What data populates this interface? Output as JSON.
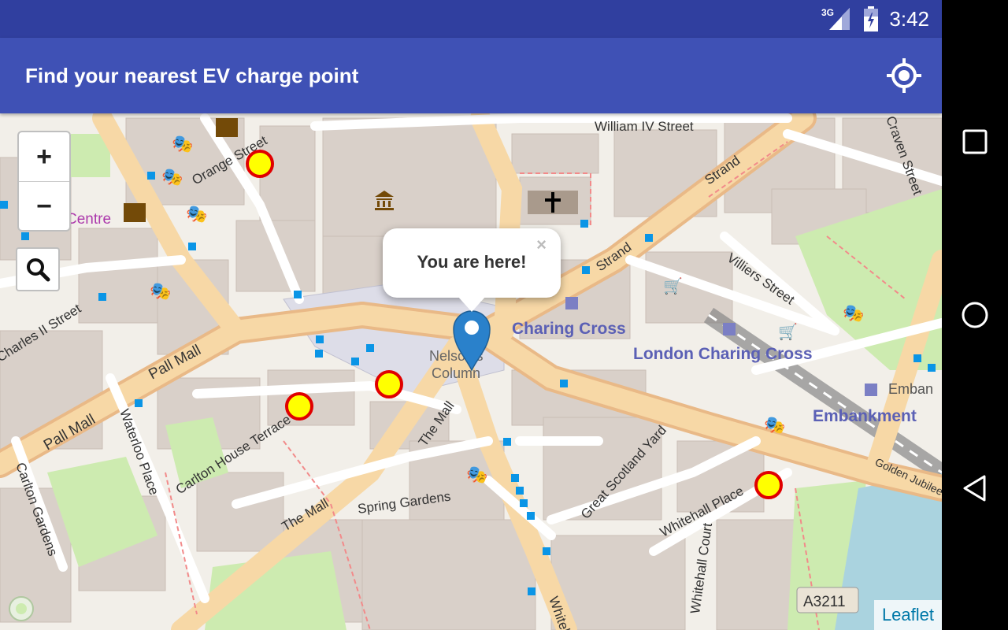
{
  "status_bar": {
    "network": "3G",
    "time": "3:42"
  },
  "app_bar": {
    "title": "Find your nearest EV charge point",
    "locate_icon": "my-location-icon"
  },
  "map": {
    "zoom_in_label": "+",
    "zoom_out_label": "−",
    "search_icon": "search-icon",
    "popup_text": "You are here!",
    "popup_close": "×",
    "attribution": "Leaflet",
    "labels": {
      "william_iv": "William IV Street",
      "strand_1": "Strand",
      "strand_2": "Strand",
      "orange_st": "Orange Street",
      "pall_mall_1": "Pall Mall",
      "pall_mall_2": "Pall Mall",
      "charles_ii": "Charles II Street",
      "waterloo_place": "Waterloo Place",
      "carlton_gardens": "Carlton Gardens",
      "carlton_house_terrace": "Carlton House Terrace",
      "the_mall_1": "The Mall",
      "the_mall_2": "The Mall",
      "spring_gardens": "Spring Gardens",
      "great_scotland_yard": "Great Scotland Yard",
      "whitehall_place": "Whitehall Place",
      "whitehall_court": "Whitehall Court",
      "whitehall": "Whitehall",
      "villiers_st": "Villiers Street",
      "charing_cross": "Charing Cross",
      "london_charing_cross": "London Charing Cross",
      "embankment": "Embankment",
      "emban": "Emban",
      "nelsons_column_1": "Nelson's",
      "nelsons_column_2": "Column",
      "centre": "Centre",
      "a3211": "A3211",
      "craven_st": "Craven Street",
      "golden_jubilee": "Golden Jubilee"
    },
    "charge_point_color": "#FFFF00",
    "charge_point_ring": "#E00000",
    "marker_color": "#2A81CB"
  }
}
